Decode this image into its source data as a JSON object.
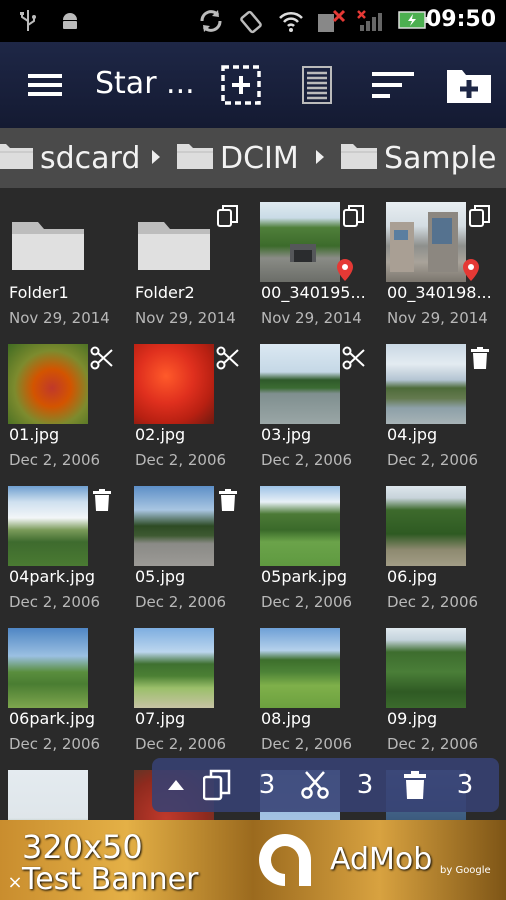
{
  "status_bar": {
    "time": "09:50",
    "icons": [
      "usb-icon",
      "android-debug-icon",
      "sync-icon",
      "rotate-icon",
      "wifi-icon",
      "sim-no-signal-icon",
      "cell-no-signal-icon",
      "battery-charging-icon"
    ]
  },
  "action_bar": {
    "title": "Star ...",
    "buttons": [
      "menu-icon",
      "select-icon",
      "list-view-icon",
      "sort-icon",
      "new-folder-icon"
    ]
  },
  "breadcrumb": [
    "sdcard",
    "DCIM",
    "Sample"
  ],
  "items": [
    {
      "name": "Folder1",
      "date": "Nov 29, 2014",
      "kind": "folder",
      "badge": "none",
      "pin": false
    },
    {
      "name": "Folder2",
      "date": "Nov 29, 2014",
      "kind": "folder",
      "badge": "copy",
      "pin": false
    },
    {
      "name": "00_340195...",
      "date": "Nov 29, 2014",
      "kind": "photo",
      "badge": "copy",
      "pin": true
    },
    {
      "name": "00_340198...",
      "date": "Nov 29, 2014",
      "kind": "photo",
      "badge": "copy",
      "pin": true
    },
    {
      "name": "01.jpg",
      "date": "Dec 2, 2006",
      "kind": "photo",
      "badge": "cut",
      "pin": false
    },
    {
      "name": "02.jpg",
      "date": "Dec 2, 2006",
      "kind": "photo",
      "badge": "cut",
      "pin": false
    },
    {
      "name": "03.jpg",
      "date": "Dec 2, 2006",
      "kind": "photo",
      "badge": "cut",
      "pin": false
    },
    {
      "name": "04.jpg",
      "date": "Dec 2, 2006",
      "kind": "photo",
      "badge": "delete",
      "pin": false
    },
    {
      "name": "04park.jpg",
      "date": "Dec 2, 2006",
      "kind": "photo",
      "badge": "delete",
      "pin": false
    },
    {
      "name": "05.jpg",
      "date": "Dec 2, 2006",
      "kind": "photo",
      "badge": "delete",
      "pin": false
    },
    {
      "name": "05park.jpg",
      "date": "Dec 2, 2006",
      "kind": "photo",
      "badge": "none",
      "pin": false
    },
    {
      "name": "06.jpg",
      "date": "Dec 2, 2006",
      "kind": "photo",
      "badge": "none",
      "pin": false
    },
    {
      "name": "06park.jpg",
      "date": "Dec 2, 2006",
      "kind": "photo",
      "badge": "none",
      "pin": false
    },
    {
      "name": "07.jpg",
      "date": "Dec 2, 2006",
      "kind": "photo",
      "badge": "none",
      "pin": false
    },
    {
      "name": "08.jpg",
      "date": "Dec 2, 2006",
      "kind": "photo",
      "badge": "none",
      "pin": false
    },
    {
      "name": "09.jpg",
      "date": "Dec 2, 2006",
      "kind": "photo",
      "badge": "none",
      "pin": false
    }
  ],
  "clipboard_bar": {
    "copy_count": "3",
    "cut_count": "3",
    "delete_count": "3"
  },
  "ad_banner": {
    "size_text": "320x50",
    "text": "Test Banner",
    "brand": "AdMob",
    "brand_sub": "by Google",
    "close": "×"
  },
  "colors": {
    "action_bar": "#1e2746",
    "breadcrumb": "#4a4a4a",
    "background": "#2a2a2a",
    "clipboard_bar": "#374173",
    "pin": "#e53935"
  }
}
